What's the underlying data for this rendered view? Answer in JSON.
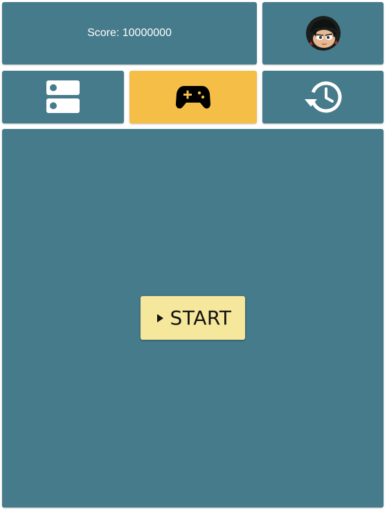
{
  "header": {
    "score_text": "Score: 10000000"
  },
  "colors": {
    "panel": "#457b8b",
    "active_tab": "#f5be47",
    "start_button": "#f5e79c"
  },
  "tabs": [
    {
      "icon": "server-list-icon",
      "active": false
    },
    {
      "icon": "gamepad-icon",
      "active": true
    },
    {
      "icon": "history-icon",
      "active": false
    }
  ],
  "profile": {
    "icon": "avatar"
  },
  "main": {
    "start_label": "START",
    "start_icon": "play-icon"
  }
}
